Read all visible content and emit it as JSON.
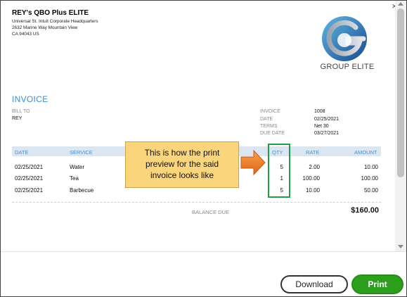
{
  "window": {
    "close_icon": "close-icon"
  },
  "company": {
    "name": "REY's QBO Plus ELITE",
    "address_lines": [
      "Universal St. Intuit Corporate Headquarters",
      "2632 Marine Way Mountain View",
      "CA  94043 US"
    ],
    "logo_text": "GROUP ELITE"
  },
  "invoice": {
    "title": "INVOICE",
    "bill_to_label": "BILL TO",
    "bill_to_value": "REY",
    "meta": [
      {
        "label": "INVOICE",
        "value": "1008"
      },
      {
        "label": "DATE",
        "value": "02/25/2021"
      },
      {
        "label": "TERMS",
        "value": "Net 30"
      },
      {
        "label": "DUE DATE",
        "value": "03/27/2021"
      }
    ]
  },
  "table": {
    "headers": {
      "date": "DATE",
      "service": "SERVICE",
      "qty": "QTY",
      "rate": "RATE",
      "amount": "AMOUNT"
    },
    "rows": [
      {
        "date": "02/25/2021",
        "service": "Water",
        "qty": "5",
        "rate": "2.00",
        "amount": "10.00"
      },
      {
        "date": "02/25/2021",
        "service": "Tea",
        "qty": "1",
        "rate": "100.00",
        "amount": "100.00"
      },
      {
        "date": "02/25/2021",
        "service": "Barbecue",
        "qty": "5",
        "rate": "10.00",
        "amount": "50.00"
      }
    ]
  },
  "balance": {
    "label": "BALANCE DUE",
    "value": "$160.00"
  },
  "callout": {
    "lines": [
      "This is how the print",
      "preview for the said",
      "invoice looks like"
    ]
  },
  "buttons": {
    "download": "Download",
    "print": "Print"
  },
  "colors": {
    "accent_blue": "#3a8fd8",
    "print_green": "#2ca01c",
    "callout_yellow": "#fbd57b",
    "arrow_orange": "#f07c1e",
    "highlight_green": "#1f9d47"
  }
}
